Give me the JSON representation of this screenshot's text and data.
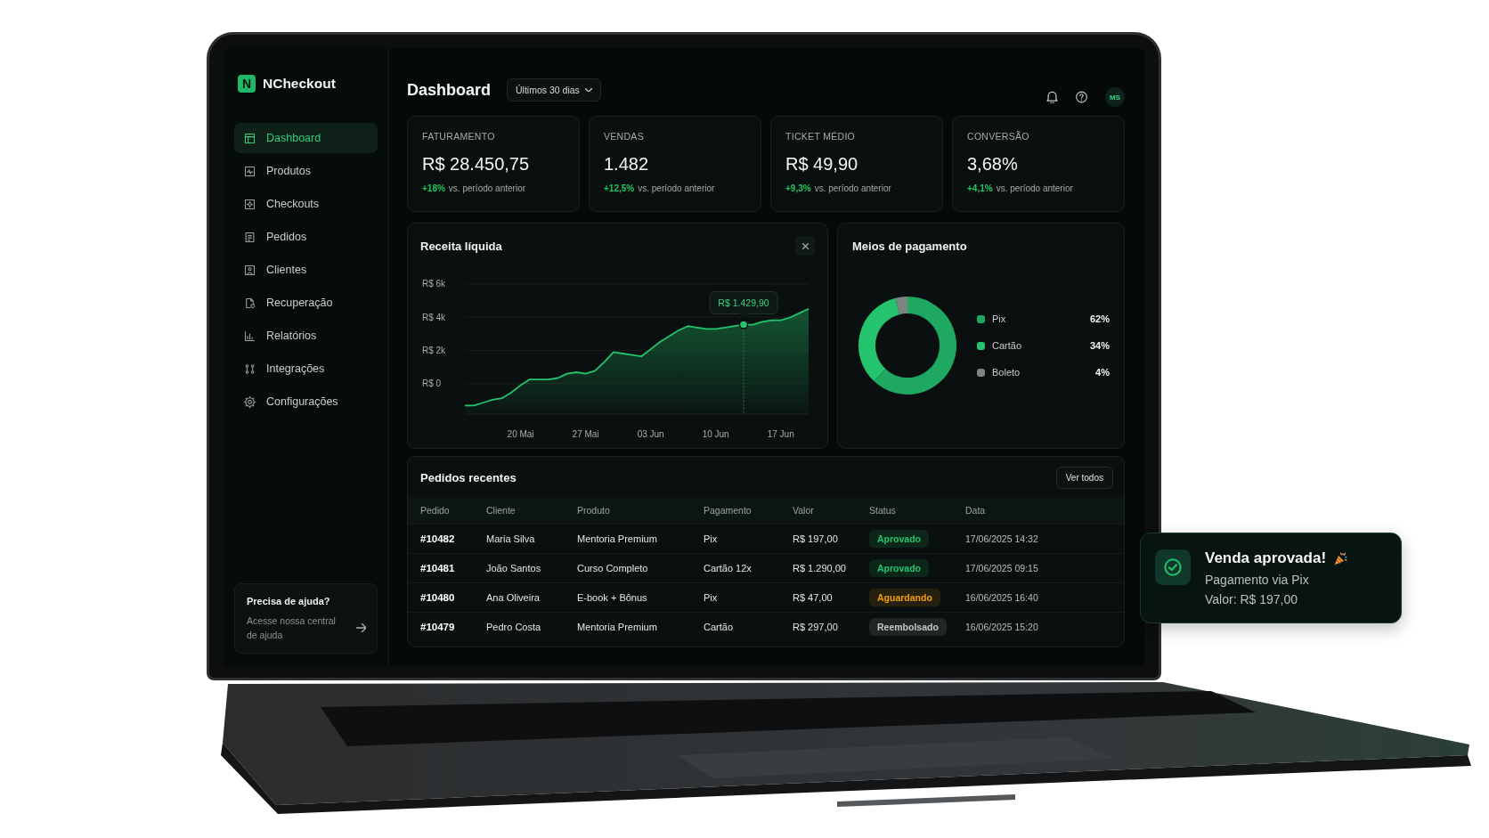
{
  "sidebar": {
    "logo": {
      "letter": "N",
      "name": "NCheckout"
    },
    "items": [
      {
        "label": "Dashboard",
        "selected": true
      },
      {
        "label": "Produtos",
        "selected": false
      },
      {
        "label": "Checkouts",
        "selected": false
      },
      {
        "label": "Pedidos",
        "selected": false
      },
      {
        "label": "Clientes",
        "selected": false
      },
      {
        "label": "Recuperação",
        "selected": false
      },
      {
        "label": "Relatórios",
        "selected": false
      },
      {
        "label": "Integrações",
        "selected": false
      },
      {
        "label": "Configurações",
        "selected": false
      }
    ],
    "help": {
      "title": "Precisa de ajuda?",
      "text": "Acesse nossa central de ajuda"
    }
  },
  "header": {
    "title": "Dashboard",
    "period": "Últimos 30 dias",
    "avatar": "MS"
  },
  "kpis": [
    {
      "label": "FATURAMENTO",
      "value": "R$ 28.450,75",
      "delta": "+18%",
      "comparison": "vs. período anterior"
    },
    {
      "label": "VENDAS",
      "value": "1.482",
      "delta": "+12,5%",
      "comparison": "vs. período anterior"
    },
    {
      "label": "TICKET MÉDIO",
      "value": "R$ 49,90",
      "delta": "+9,3%",
      "comparison": "vs. período anterior"
    },
    {
      "label": "CONVERSÃO",
      "value": "3,68%",
      "delta": "+4,1%",
      "comparison": "vs. período anterior"
    }
  ],
  "revenue": {
    "title": "Receita líquida",
    "y_axis_labels": [
      "R$ 6k",
      "R$ 4k",
      "R$ 2k",
      "R$ 0"
    ],
    "x_axis_labels": [
      "20 Mai",
      "27 Mai",
      "03 Jun",
      "10 Jun",
      "17 Jun"
    ],
    "tooltip": "R$ 1.429,90"
  },
  "payments": {
    "chart_data": {
      "type": "donut",
      "title": "Meios de pagamento",
      "categories": [
        "Pix",
        "Cartão",
        "Boleto"
      ],
      "values": [
        62,
        34,
        4
      ],
      "colors": [
        "#1fa862",
        "#24c46f",
        "#7d8581"
      ],
      "value_labels": [
        "62%",
        "34%",
        "4%"
      ]
    }
  },
  "orders": {
    "title": "Pedidos recentes",
    "action": "Ver todos",
    "columns": [
      "Pedido",
      "Cliente",
      "Produto",
      "Pagamento",
      "Valor",
      "Status",
      "Data"
    ],
    "rows": [
      {
        "order": "#10482",
        "client": "Maria Silva",
        "product": "Mentoria Premium",
        "payment": "Pix",
        "value": "R$ 197,00",
        "status": {
          "label": "Aprovado",
          "color": "#22c56e"
        },
        "date": "17/06/2025 14:32"
      },
      {
        "order": "#10481",
        "client": "João Santos",
        "product": "Curso Completo",
        "payment": "Cartão 12x",
        "value": "R$ 1.290,00",
        "status": {
          "label": "Aprovado",
          "color": "#22c56e"
        },
        "date": "17/06/2025 09:15"
      },
      {
        "order": "#10480",
        "client": "Ana Oliveira",
        "product": "E-book + Bônus",
        "payment": "Pix",
        "value": "R$ 47,00",
        "status": {
          "label": "Aguardando",
          "color": "#f59e0b"
        },
        "date": "16/06/2025 16:40"
      },
      {
        "order": "#10479",
        "client": "Pedro Costa",
        "product": "Mentoria Premium",
        "payment": "Cartão",
        "value": "R$ 297,00",
        "status": {
          "label": "Reembolsado",
          "color": "#c4c9c7"
        },
        "date": "16/06/2025 15:20"
      }
    ]
  },
  "toast": {
    "title": "Venda aprovada!",
    "lines": [
      "Pagamento via Pix",
      "Valor: R$ 197,00"
    ]
  }
}
